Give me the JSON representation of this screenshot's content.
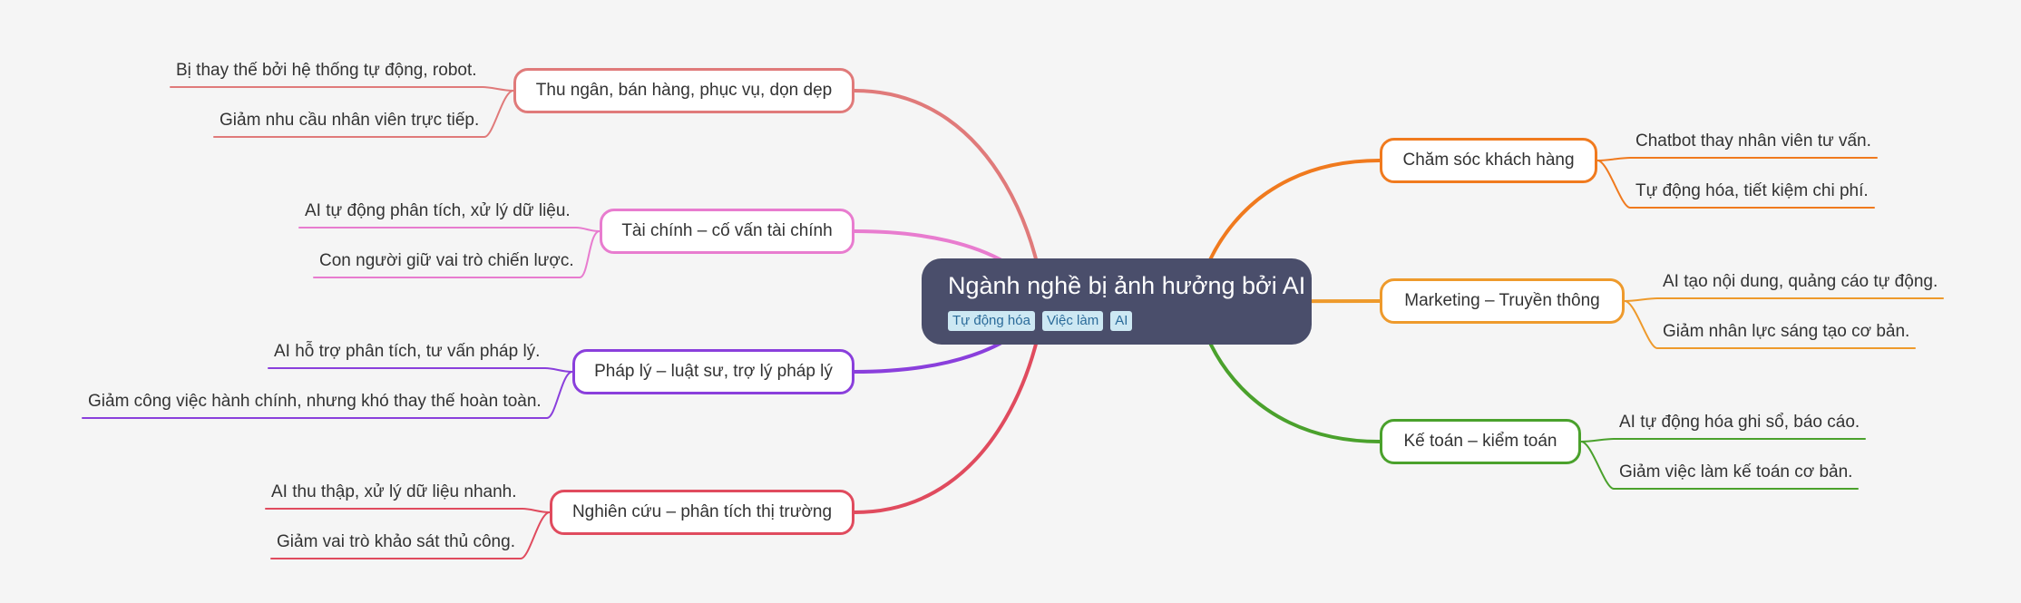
{
  "root": {
    "title": "Ngành nghề bị ảnh hưởng bởi AI",
    "tags": [
      "Tự động hóa",
      "Việc làm",
      "AI"
    ]
  },
  "branches": [
    {
      "topic": "Thu ngân, bán hàng, phục vụ, dọn dẹp",
      "color": "#e07a7a",
      "details": [
        "Bị thay thế bởi hệ thống tự động, robot.",
        "Giảm nhu cầu nhân viên trực tiếp."
      ]
    },
    {
      "topic": "Tài chính – cố vấn tài chính",
      "color": "#e87ccf",
      "details": [
        "AI tự động phân tích, xử lý dữ liệu.",
        "Con người giữ vai trò chiến lược."
      ]
    },
    {
      "topic": "Pháp lý – luật sư, trợ lý pháp lý",
      "color": "#8a3fdc",
      "details": [
        "AI hỗ trợ phân tích, tư vấn pháp lý.",
        "Giảm công việc hành chính, nhưng khó thay thế hoàn toàn."
      ]
    },
    {
      "topic": "Nghiên cứu – phân tích thị trường",
      "color": "#e04b5e",
      "details": [
        "AI thu thập, xử lý dữ liệu nhanh.",
        "Giảm vai trò khảo sát thủ công."
      ]
    },
    {
      "topic": "Chăm sóc khách hàng",
      "color": "#f07a1e",
      "details": [
        "Chatbot thay nhân viên tư vấn.",
        "Tự động hóa, tiết kiệm chi phí."
      ]
    },
    {
      "topic": "Marketing – Truyền thông",
      "color": "#ee9a2c",
      "details": [
        "AI tạo nội dung, quảng cáo tự động.",
        "Giảm nhân lực sáng tạo cơ bản."
      ]
    },
    {
      "topic": "Kế toán – kiểm toán",
      "color": "#4aa12c",
      "details": [
        "AI tự động hóa ghi sổ, báo cáo.",
        "Giảm việc làm kế toán cơ bản."
      ]
    }
  ]
}
